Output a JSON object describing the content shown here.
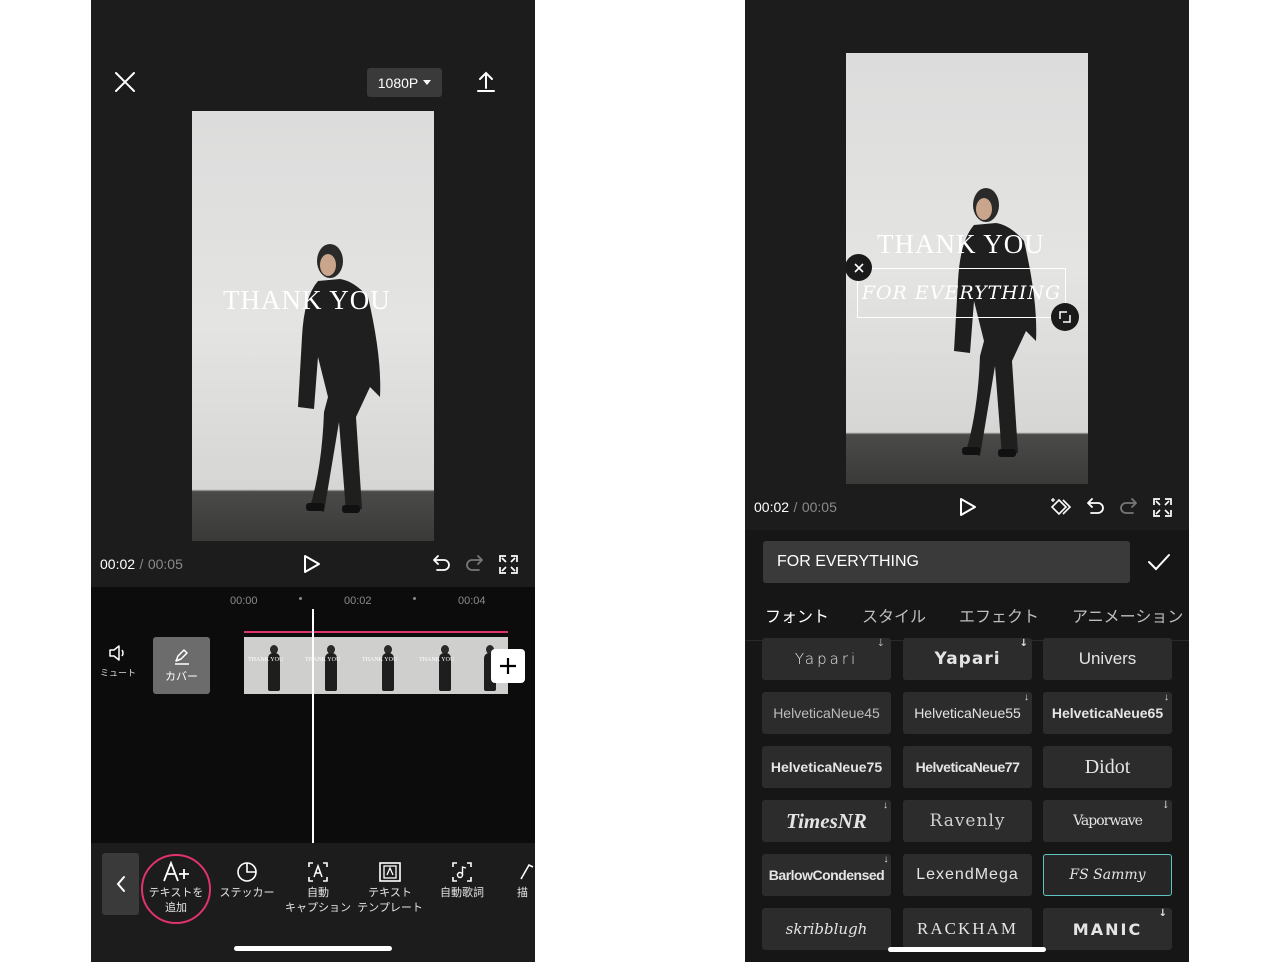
{
  "left_screen": {
    "resolution": "1080P",
    "preview_text": "THANK YOU",
    "time": {
      "current": "00:02",
      "separator": "/",
      "total": "00:05"
    },
    "ruler": [
      "00:00",
      "00:02",
      "00:04"
    ],
    "mute_label": "ミュート",
    "cover_label": "カバー",
    "clip_thumb_text": "THANK YOU",
    "toolbar": [
      {
        "label": "テキストを追加",
        "icon": "text-add-icon"
      },
      {
        "label": "ステッカー",
        "icon": "sticker-icon"
      },
      {
        "label": "自動\nキャプション",
        "icon": "auto-caption-icon"
      },
      {
        "label": "テキスト\nテンプレート",
        "icon": "text-template-icon"
      },
      {
        "label": "自動歌詞",
        "icon": "auto-lyrics-icon"
      },
      {
        "label": "描",
        "icon": "draw-icon"
      }
    ],
    "highlight_color": "#e0336e"
  },
  "right_screen": {
    "preview_text_top": "THANK YOU",
    "preview_text_box": "FOR EVERYTHING",
    "time": {
      "current": "00:02",
      "separator": "/",
      "total": "00:05"
    },
    "text_input_value": "FOR EVERYTHING",
    "tabs": [
      "フォント",
      "スタイル",
      "エフェクト",
      "アニメーション"
    ],
    "active_tab": "フォント",
    "fonts": [
      {
        "name": "Yapari",
        "download": true
      },
      {
        "name": "Yapari",
        "download": true
      },
      {
        "name": "Univers",
        "download": false
      },
      {
        "name": "HelveticaNeue45",
        "download": false
      },
      {
        "name": "HelveticaNeue55",
        "download": true
      },
      {
        "name": "HelveticaNeue65",
        "download": true
      },
      {
        "name": "HelveticaNeue75",
        "download": false
      },
      {
        "name": "HelveticaNeue77",
        "download": false
      },
      {
        "name": "Didot",
        "download": false
      },
      {
        "name": "TimesNR",
        "download": true
      },
      {
        "name": "Ravenly",
        "download": false
      },
      {
        "name": "Vaporwave",
        "download": true
      },
      {
        "name": "BarlowCondensed",
        "download": true
      },
      {
        "name": "LexendMega",
        "download": false
      },
      {
        "name": "FS Sammy",
        "download": false
      },
      {
        "name": "skribblugh",
        "download": false
      },
      {
        "name": "RACKHAM",
        "download": false
      },
      {
        "name": "MANIC",
        "download": true
      }
    ],
    "selected_font": "FS Sammy",
    "selected_color": "#5fc3c0"
  }
}
